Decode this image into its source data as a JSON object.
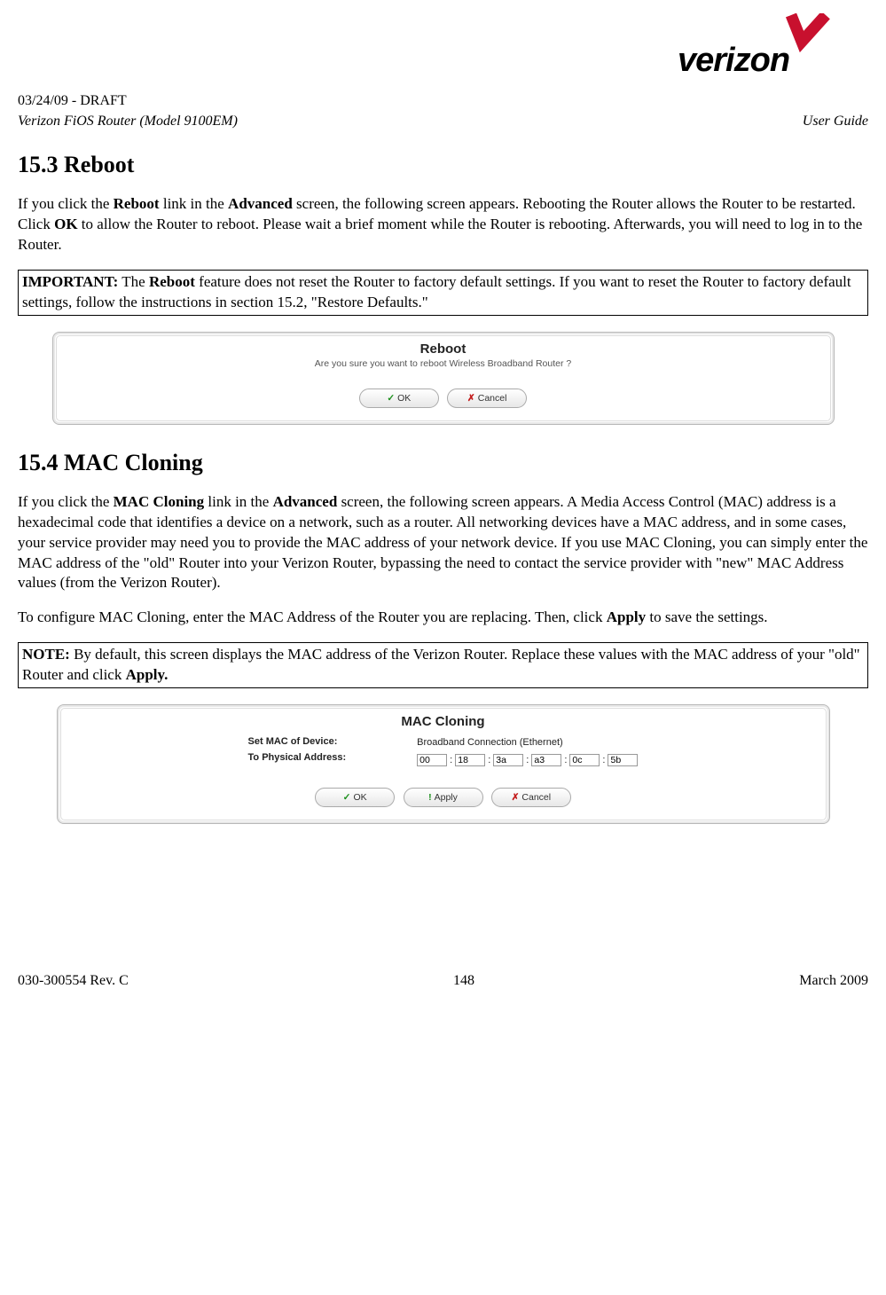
{
  "header": {
    "draft_line": "03/24/09 - DRAFT",
    "device_line": "Verizon FiOS Router (Model 9100EM)",
    "doc_type": "User Guide"
  },
  "section_reboot": {
    "title": "15.3   Reboot",
    "intro_pre": "If you click the ",
    "intro_bold1": "Reboot",
    "intro_mid1": " link in the ",
    "intro_bold2": "Advanced",
    "intro_mid2": " screen, the following screen appears. Rebooting the Router allows the Router to be restarted. Click ",
    "intro_bold3": "OK",
    "intro_post": " to allow the Router to reboot. Please wait a brief moment while the Router is rebooting. Afterwards, you will need to log in to the Router.",
    "important_label": "IMPORTANT:",
    "important_text1": " The ",
    "important_bold": "Reboot",
    "important_text2": " feature does not reset the Router to factory default settings. If you want to reset the Router to factory default settings, follow the instructions in section 15.2, \"Restore Defaults.\""
  },
  "reboot_dialog": {
    "title": "Reboot",
    "message": "Are you sure you want to reboot Wireless Broadband Router ?",
    "ok": "OK",
    "cancel": "Cancel"
  },
  "section_mac": {
    "title": "15.4   MAC Cloning",
    "p1_pre": "If you click the ",
    "p1_b1": "MAC Cloning",
    "p1_mid": " link in the ",
    "p1_b2": "Advanced",
    "p1_post": " screen, the following screen appears. A Media Access Control (MAC) address is a hexadecimal code that identifies a device on a network, such as a router. All networking devices have a MAC address, and in some cases, your service provider may need you to provide the MAC address of your network device. If you use MAC Cloning, you can simply enter the MAC address of the \"old\" Router into your Verizon Router, bypassing the need to contact the service provider with \"new\" MAC Address values (from the Verizon Router).",
    "p2_pre": "To configure MAC Cloning, enter the MAC Address of the Router you are replacing. Then, click ",
    "p2_b": "Apply",
    "p2_post": " to save the settings.",
    "note_label": "NOTE:",
    "note_text1": " By default, this screen displays the MAC address of the Verizon Router. Replace these values with the MAC address of your \"old\" Router and click ",
    "note_bold": "Apply."
  },
  "mac_dialog": {
    "title": "MAC Cloning",
    "label1": "Set MAC of Device:",
    "label2": "To Physical Address:",
    "device_value": "Broadband Connection (Ethernet)",
    "mac": [
      "00",
      "18",
      "3a",
      "a3",
      "0c",
      "5b"
    ],
    "ok": "OK",
    "apply": "Apply",
    "cancel": "Cancel"
  },
  "footer": {
    "left": "030-300554 Rev. C",
    "center": "148",
    "right": "March 2009"
  }
}
